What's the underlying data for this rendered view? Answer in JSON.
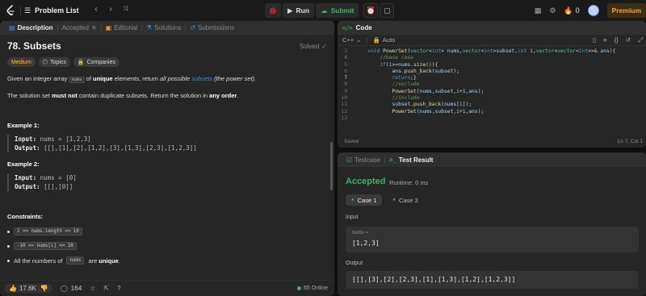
{
  "topbar": {
    "problem_list": "Problem List",
    "run": "Run",
    "submit": "Submit",
    "notifications": "0",
    "premium": "Premium"
  },
  "left": {
    "tabs": [
      {
        "label": "Description"
      },
      {
        "label": "Accepted"
      },
      {
        "label": "Editorial"
      },
      {
        "label": "Solutions"
      },
      {
        "label": "Submissions"
      }
    ],
    "title": "78. Subsets",
    "solved": "Solved",
    "tags": {
      "difficulty": "Medium",
      "topics": "Topics",
      "companies": "Companies"
    },
    "p1_a": "Given an integer array",
    "p1_chip": "nums",
    "p1_b": "of",
    "p1_c": "unique",
    "p1_d": "elements, return",
    "p1_e": "all possible",
    "p1_f": "subsets",
    "p1_g": "(the power set).",
    "p2_a": "The solution set",
    "p2_b": "must not",
    "p2_c": "contain duplicate subsets. Return the solution in",
    "p2_d": "any order",
    "p2_e": ".",
    "ex1_title": "Example 1:",
    "ex1_input_label": "Input:",
    "ex1_input": "nums = [1,2,3]",
    "ex1_output_label": "Output:",
    "ex1_output": "[[],[1],[2],[1,2],[3],[1,3],[2,3],[1,2,3]]",
    "ex2_title": "Example 2:",
    "ex2_input_label": "Input:",
    "ex2_input": "nums = [0]",
    "ex2_output_label": "Output:",
    "ex2_output": "[[],[0]]",
    "constraints_title": "Constraints:",
    "c1": "1 <= nums.length <= 10",
    "c2": "-10 <= nums[i] <= 10",
    "c3_a": "All the numbers of",
    "c3_chip": "nums",
    "c3_b": "are",
    "c3_c": "unique",
    "c3_d": ".",
    "likes": "17.6K",
    "comments": "164",
    "online": "65 Online"
  },
  "code": {
    "title": "Code",
    "lang": "C++",
    "mode": "Auto",
    "saved": "Saved",
    "cursor": "Ln 7, Col 1",
    "lines": [
      {
        "n": "3",
        "t": "    void PowerSet(vector<int> nums,vector<int>subset,int i,vector<vector<int>>& ans){"
      },
      {
        "n": "4",
        "t": "        //base case"
      },
      {
        "n": "5",
        "t": "        if(i>=nums.size()){"
      },
      {
        "n": "6",
        "t": "            ans.push_back(subset);"
      },
      {
        "n": "7",
        "t": "            return;}"
      },
      {
        "n": "8",
        "t": "            //exclude"
      },
      {
        "n": "9",
        "t": "            PowerSet(nums,subset,i+1,ans);"
      },
      {
        "n": "10",
        "t": "            //include"
      },
      {
        "n": "11",
        "t": "            subset.push_back(nums[i]);"
      },
      {
        "n": "12",
        "t": "            PowerSet(nums,subset,i+1,ans);"
      },
      {
        "n": "13",
        "t": ""
      }
    ]
  },
  "test": {
    "tab_testcase": "Testcase",
    "tab_result": "Test Result",
    "status": "Accepted",
    "runtime": "Runtime: 0 ms",
    "case1": "Case 1",
    "case2": "Case 2",
    "input_label": "Input",
    "input_var": "nums =",
    "input_value": "[1,2,3]",
    "output_label": "Output",
    "output_value": "[[],[3],[2],[2,3],[1],[1,3],[1,2],[1,2,3]]"
  }
}
